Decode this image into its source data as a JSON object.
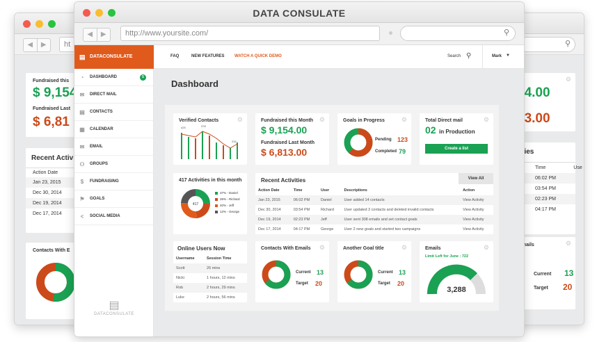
{
  "title": "DATA CONSULATE",
  "url": "http://www.yoursite.com/",
  "left_url": "ht",
  "brand": "DATACONSULATE",
  "topnav": {
    "faq": "FAQ",
    "features": "NEW FEATURES",
    "demo": "WATCH A QUICK DEMO",
    "search": "Search",
    "user": "Mark"
  },
  "sidebar": [
    {
      "label": "DASHBOARD",
      "icon": "dashboard-icon",
      "badge": "5"
    },
    {
      "label": "DIRECT MAIL",
      "icon": "mail-icon"
    },
    {
      "label": "CONTACTS",
      "icon": "contacts-icon"
    },
    {
      "label": "CALENDAR",
      "icon": "calendar-icon"
    },
    {
      "label": "EMAIL",
      "icon": "email-icon"
    },
    {
      "label": "GROUPS",
      "icon": "groups-icon"
    },
    {
      "label": "FUNDRAISING",
      "icon": "fundraising-icon"
    },
    {
      "label": "GOALS",
      "icon": "flag-icon"
    },
    {
      "label": "SOCIAL MEDIA",
      "icon": "share-icon"
    }
  ],
  "sidebar_logo": "DATACONSULATE",
  "page_title": "Dashboard",
  "verified": {
    "title": "Verified Contacts",
    "labels": [
      "425",
      "378",
      "234"
    ]
  },
  "fund": {
    "this_label": "Fundraised this Month",
    "this_value": "$ 9,154.00",
    "last_label": "Fundraised Last Month",
    "last_value": "$ 6,813.00"
  },
  "goals": {
    "title": "Goals in Progress",
    "pending_label": "Pending",
    "pending": "123",
    "completed_label": "Completed",
    "completed": "79"
  },
  "directmail": {
    "title": "Total Direct mail",
    "count": "02",
    "suffix": "in Production",
    "button": "Create a list"
  },
  "activities_pie": {
    "title": "417 Activities in this month",
    "center": "417",
    "legend": [
      "37% - Daniel",
      "35% - Richard",
      "40% - Jeff",
      "12% - George"
    ]
  },
  "recent": {
    "title": "Recent Activities",
    "view_all": "View All",
    "headers": [
      "Action Date",
      "Time",
      "User",
      "Descriptions",
      "Action"
    ],
    "rows": [
      [
        "Jan 23, 2015",
        "06:02 PM",
        "Daniel",
        "User added 14 contacts",
        "View Activity"
      ],
      [
        "Dec 30, 2014",
        "03:54 PM",
        "Richard",
        "User updated 3 contacts and deleted invalid contacts",
        "View Activity"
      ],
      [
        "Dec 19, 2014",
        "02:23 PM",
        "Jeff",
        "User sent 308 emails and set contact goals",
        "View Activity"
      ],
      [
        "Dec 17, 2014",
        "04:17 PM",
        "George",
        "User 2 new goals and started two campaigns",
        "View Activity"
      ]
    ]
  },
  "online": {
    "title": "Online Users Now",
    "headers": [
      "Username",
      "Session Time"
    ],
    "rows": [
      [
        "Scott",
        "26 mins"
      ],
      [
        "Nicki",
        "1 hours, 12 mins"
      ],
      [
        "Rob",
        "2 hours, 29 mins"
      ],
      [
        "Luke",
        "2 hours, 56 mins"
      ]
    ]
  },
  "contacts_emails": {
    "title": "Contacts With Emails",
    "current_label": "Current",
    "current": "13",
    "target_label": "Target",
    "target": "20"
  },
  "another_goal": {
    "title": "Another Goal title",
    "current_label": "Current",
    "current": "13",
    "target_label": "Target",
    "target": "20"
  },
  "emails": {
    "title": "Emails",
    "limit": "Limit Left for June : 722",
    "value": "3,288"
  },
  "left": {
    "fund_this": "Fundraised this",
    "val1": "$ 9,154",
    "fund_last": "Fundraised Last",
    "val2": "$ 6,81",
    "recent": "Recent Activi",
    "action_date": "Action Date",
    "dates": [
      "Jan 23, 2015",
      "Dec 30, 2014",
      "Dec 19, 2014",
      "Dec 17, 2014"
    ],
    "contacts": "Contacts With E"
  },
  "right": {
    "fund_this": "h",
    "val1": "54.00",
    "fund_last": "h",
    "val2": "13.00",
    "activities": "ivities",
    "time": "Time",
    "use": "Use",
    "times": [
      "06:02 PM",
      "03:54 PM",
      "02:23 PM",
      "04:17 PM"
    ],
    "emails_title": "h Emails",
    "current": "Current",
    "current_val": "13",
    "target": "Target",
    "target_val": "20"
  },
  "colors": {
    "green": "#1aa153",
    "orange": "#cc4a1a",
    "brand": "#e05a1c"
  }
}
